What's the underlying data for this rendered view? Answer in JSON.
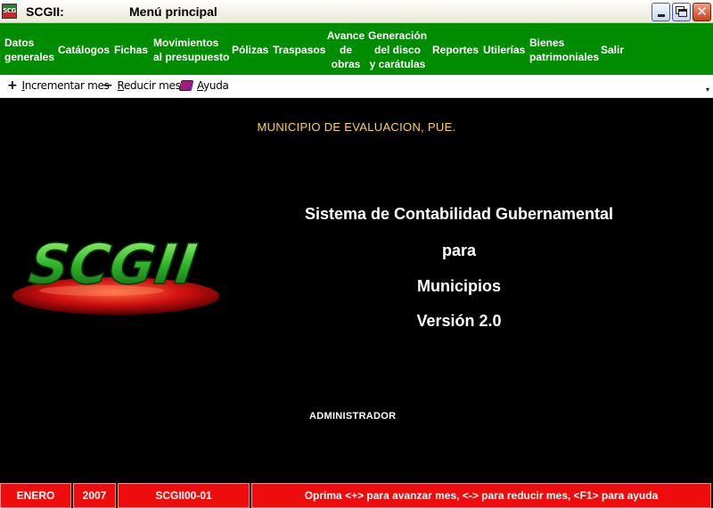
{
  "window": {
    "app_title": "SCGII:",
    "form_title": "Menú principal",
    "icon_text": "SCG"
  },
  "menu": {
    "items": [
      {
        "label_1": "Datos",
        "label_2": "generales"
      },
      {
        "label": "Catálogos"
      },
      {
        "label": "Fichas"
      },
      {
        "label_1": "Movimientos",
        "label_2": "al presupuesto"
      },
      {
        "label": "Pólizas"
      },
      {
        "label": "Traspasos"
      },
      {
        "label_1": "Avance",
        "label_2": "de",
        "label_3": "obras"
      },
      {
        "label_1": "Generación",
        "label_2": "del disco",
        "label_3": "y carátulas"
      },
      {
        "label": "Reportes"
      },
      {
        "label": "Utilerías"
      },
      {
        "label_1": "Bienes",
        "label_2": "patrimoniales"
      },
      {
        "label": "Salir"
      }
    ]
  },
  "toolbar": {
    "increment": {
      "icon": "+",
      "mnemonic": "I",
      "rest": "ncrementar mes"
    },
    "decrease": {
      "icon": "−",
      "mnemonic": "R",
      "rest": "educir mes"
    },
    "help": {
      "mnemonic": "A",
      "rest": "yuda"
    },
    "chevron": "▾"
  },
  "main": {
    "municipio": "MUNICIPIO DE EVALUACION, PUE.",
    "logo_text": "SCGII",
    "lines": [
      "Sistema de Contabilidad Gubernamental",
      "para",
      "Municipios",
      "Versión 2.0"
    ],
    "user": "ADMINISTRADOR"
  },
  "status": {
    "month": "ENERO",
    "year": "2007",
    "code": "SCGII00-01",
    "hint": "Oprima <+> para avanzar mes, <-> para reducir mes, <F1> para ayuda"
  },
  "colors": {
    "menu_bg": "#008c00",
    "status_bg": "#ef0c0c",
    "municipio_text": "#ffd44a"
  }
}
